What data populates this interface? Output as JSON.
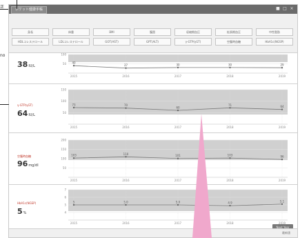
{
  "side_notes": [
    "正",
    "no"
  ],
  "app": {
    "tab_title": "ポケット健康手帳",
    "window_controls": [
      "■",
      "□",
      "×"
    ]
  },
  "toolbar": {
    "row1": [
      "身長",
      "体重",
      "BMI",
      "腹囲",
      "収縮期血圧",
      "拡張期血圧",
      "中性脂肪"
    ],
    "row2": [
      "HDLコレステロール",
      "LDLコレステロール",
      "GOT(AST)",
      "GPT(ALT)",
      "γ-GTP(γGT)",
      "空腹時血糖",
      "HbA1c(NGSP)"
    ]
  },
  "panels": [
    {
      "label": "",
      "value": "38",
      "unit": "IU/L"
    },
    {
      "label": "γ-GTP(γGT)",
      "value": "64",
      "unit": "IU/L"
    },
    {
      "label": "空腹時血糖",
      "value": "96",
      "unit": "mg/dl"
    },
    {
      "label": "HbA1c(NGSP)",
      "value": "5",
      "unit": "%"
    }
  ],
  "chart_data": [
    {
      "type": "line",
      "x": [
        "2015",
        "2016",
        "2017",
        "2018",
        "2019"
      ],
      "y": [
        40,
        27,
        30,
        30,
        29
      ],
      "labels": [
        "40",
        "27",
        "30",
        "30",
        "29"
      ],
      "ytick_labels": [
        "100",
        "50"
      ],
      "ylim": [
        0,
        100
      ]
    },
    {
      "type": "line",
      "x": [
        "2015",
        "2016",
        "2017",
        "2018",
        "2019"
      ],
      "y": [
        72,
        70,
        60,
        71,
        64
      ],
      "labels": [
        "73",
        "70",
        "60",
        "71",
        "64"
      ],
      "ytick_labels": [
        "150",
        "100",
        "50"
      ],
      "ylim": [
        0,
        150
      ]
    },
    {
      "type": "line",
      "x": [
        "2015",
        "2016",
        "2017",
        "2018",
        "2019"
      ],
      "y": [
        103,
        110,
        101,
        103,
        96
      ],
      "labels": [
        "103",
        "110",
        "101",
        "103",
        "96"
      ],
      "ytick_labels": [
        "200",
        "150",
        "100",
        "50"
      ],
      "ylim": [
        0,
        200
      ]
    },
    {
      "type": "line",
      "x": [
        "2015",
        "2016",
        "2017",
        "2018",
        "2019"
      ],
      "y": [
        5.0,
        5.0,
        5.0,
        4.9,
        5.1
      ],
      "labels": [
        "5",
        "5.0",
        "5.0",
        "4.9",
        "5.1"
      ],
      "ytick_labels": [
        "7",
        "6",
        "5",
        "4"
      ],
      "ylim": [
        3,
        7
      ]
    }
  ],
  "next_button": "Next Year",
  "footer": "最新値",
  "colors": {
    "chart_band": "#d0d0d0",
    "line": "#777777",
    "arrow": "#f0a8cc",
    "label": "#c0392b"
  }
}
